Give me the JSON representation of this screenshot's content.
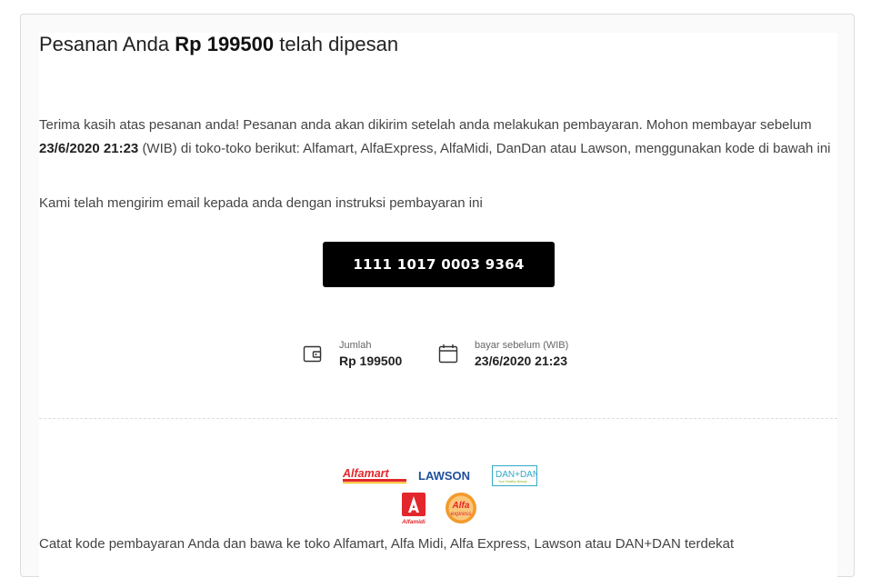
{
  "header": {
    "title_prefix": "Pesanan Anda",
    "amount": "Rp 199500",
    "title_suffix": "telah dipesan"
  },
  "message": {
    "line1_prefix": "Terima kasih atas pesanan anda! Pesanan anda akan dikirim setelah anda melakukan pembayaran. Mohon membayar sebelum",
    "deadline": "23/6/2020 21:23",
    "line1_suffix": "(WIB) di toko-toko berikut: Alfamart, AlfaExpress, AlfaMidi, DanDan atau Lawson, menggunakan kode di bawah ini",
    "email_note": "Kami telah mengirim email kepada anda dengan instruksi pembayaran ini"
  },
  "payment_code": "1111 1017 0003 9364",
  "summary": {
    "amount_label": "Jumlah",
    "amount_value": "Rp 199500",
    "deadline_label": "bayar sebelum (WIB)",
    "deadline_value": "23/6/2020 21:23"
  },
  "stores": {
    "alfamart": "Alfamart",
    "lawson": "LAWSON",
    "dandan": "DAN+DAN",
    "dandan_sub": "Your Healthy Beauty",
    "alfamidi": "Alfamidi",
    "alfa_express_top": "Alfa",
    "alfa_express_bottom": "express"
  },
  "footer_note": "Catat kode pembayaran Anda dan bawa ke toko Alfamart, Alfa Midi, Alfa Express, Lawson atau DAN+DAN terdekat",
  "colors": {
    "code_bg": "#000000",
    "alfamart_red": "#e3262b",
    "lawson_blue": "#1f4f9c",
    "dandan_teal": "#33a9c9",
    "alfa_express_orange": "#f39a2b"
  }
}
